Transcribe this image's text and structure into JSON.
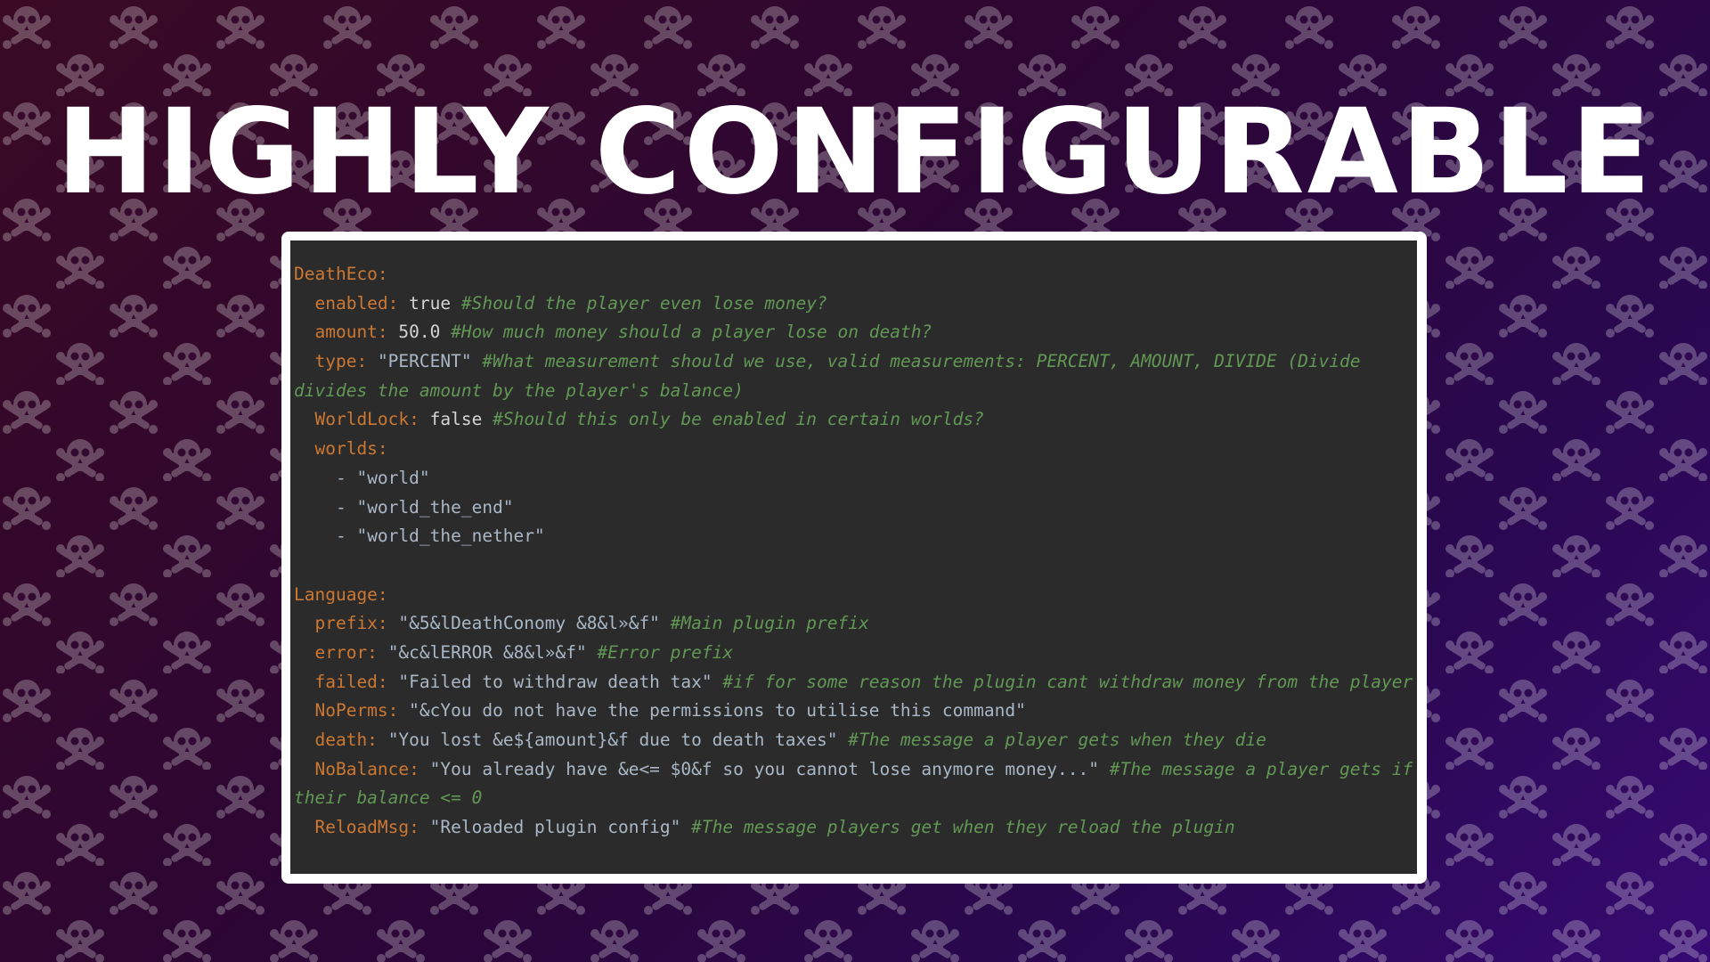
{
  "colors": {
    "background_start": "#3a0a24",
    "background_end": "#360a72",
    "pattern": "#ffffff",
    "editor_background": "#2b2b2b",
    "key": "#cc7832",
    "comment": "#629755",
    "string": "#a9b7c6"
  },
  "background_icon": "skull-and-crossbones-icon",
  "headline": "HIGHLY CONFIGURABLE",
  "config": {
    "deatheco": {
      "section": "DeathEco:",
      "enabled": {
        "key": "enabled:",
        "value": "true",
        "comment": "#Should the player even lose money?"
      },
      "amount": {
        "key": "amount:",
        "value": "50.0",
        "comment": "#How much money should a player lose on death?"
      },
      "type": {
        "key": "type:",
        "value": "\"PERCENT\"",
        "comment": "#What measurement should we use, valid measurements: PERCENT, AMOUNT, DIVIDE (Divide",
        "comment_wrap": "divides the amount by the player's balance)"
      },
      "worldlock": {
        "key": "WorldLock:",
        "value": "false",
        "comment": "#Should this only be enabled in certain worlds?"
      },
      "worlds": {
        "key": "worlds:",
        "items": [
          "- \"world\"",
          "- \"world_the_end\"",
          "- \"world_the_nether\""
        ]
      }
    },
    "language": {
      "section": "Language:",
      "prefix": {
        "key": "prefix:",
        "value": "\"&5&lDeathConomy &8&l»&f\"",
        "comment": "#Main plugin prefix"
      },
      "error": {
        "key": "error:",
        "value": "\"&c&lERROR &8&l»&f\"",
        "comment": "#Error prefix"
      },
      "failed": {
        "key": "failed:",
        "value": "\"Failed to withdraw death tax\"",
        "comment": "#if for some reason the plugin cant withdraw money from the player"
      },
      "noperms": {
        "key": "NoPerms:",
        "value": "\"&cYou do not have the permissions to utilise this command\""
      },
      "death": {
        "key": "death:",
        "value": "\"You lost &e${amount}&f due to death taxes\"",
        "comment": "#The message a player gets when they die"
      },
      "nobalance": {
        "key": "NoBalance:",
        "value": "\"You already have &e<= $0&f so you cannot lose anymore money...\"",
        "comment": "#The message a player gets if",
        "comment_wrap": "their balance <= 0"
      },
      "reloadmsg": {
        "key": "ReloadMsg:",
        "value": "\"Reloaded plugin config\"",
        "comment": "#The message players get when they reload the plugin"
      }
    }
  }
}
